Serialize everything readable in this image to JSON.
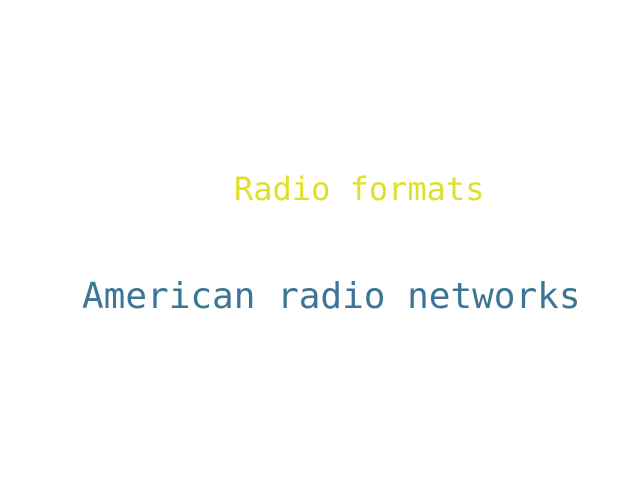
{
  "words": [
    {
      "text": "Radio formats",
      "color": "#dfe02c"
    },
    {
      "text": "American radio networks",
      "color": "#3b7696"
    }
  ]
}
